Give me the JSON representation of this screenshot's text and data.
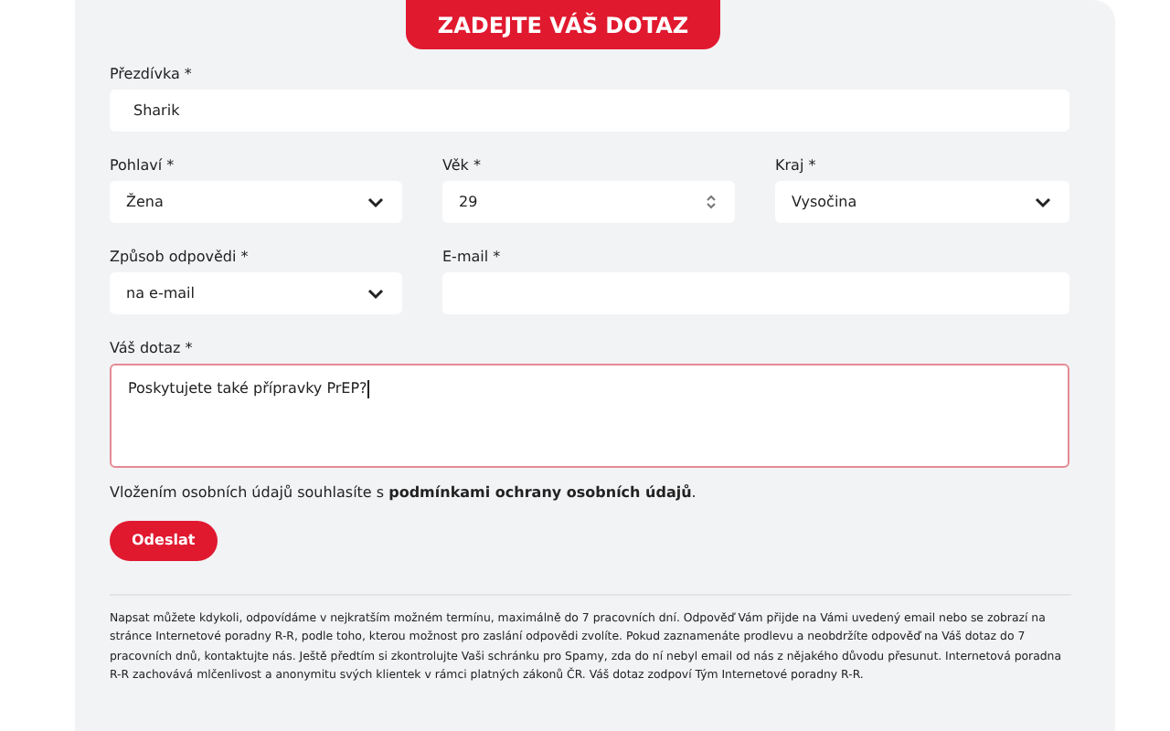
{
  "header": {
    "title": "ZADEJTE VÁŠ DOTAZ"
  },
  "fields": [
    {
      "kind": "text",
      "label": "Přezdívka *",
      "value": "Sharik"
    },
    {
      "kind": "select",
      "label": "Pohlaví *",
      "value": "Žena"
    },
    {
      "kind": "number",
      "label": "Věk *",
      "value": "29"
    },
    {
      "kind": "select",
      "label": "Kraj *",
      "value": "Vysočina"
    },
    {
      "kind": "select",
      "label": "Způsob odpovědi *",
      "value": "na e-mail"
    },
    {
      "kind": "text",
      "label": "E-mail *"
    },
    {
      "kind": "textarea",
      "label": "Váš dotaz *",
      "value": "Poskytujete také přípravky PrEP?",
      "invalid": true
    }
  ],
  "consent": {
    "text": "Vložením osobních údajů souhlasíte s ",
    "link": "podmínkami ochrany osobních údajů",
    "end": "."
  },
  "submit": "Odeslat",
  "footer_note": "Napsat můžete kdykoli, odpovídáme v nejkratším možném termínu, maximálně do 7 pracovních dní. Odpověď Vám přijde na Vámi uvedený email nebo se zobrazí na stránce Internetové poradny R-R, podle toho, kterou možnost pro zaslání odpovědi zvolíte. Pokud zaznamenáte prodlevu a neobdržíte odpověď na Váš dotaz do 7 pracovních dnů, kontaktujte nás. Ještě předtím si zkontrolujte Vaši schránku pro Spamy, zda do ní nebyl email od nás z nějakého důvodu přesunut. Internetová poradna R-R zachovává mlčenlivost a anonymitu svých klientek v rámci platných zákonů ČR. Váš dotaz zodpoví Tým Internetové poradny R-R."
}
